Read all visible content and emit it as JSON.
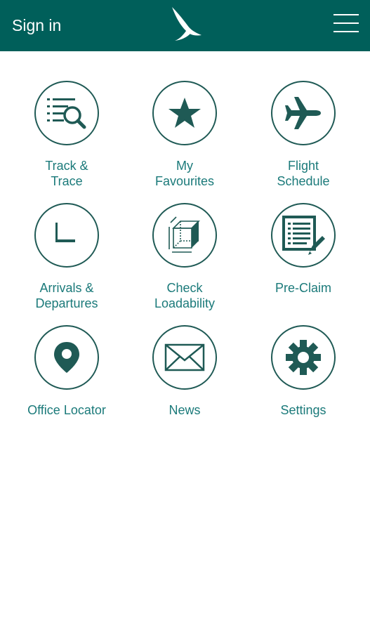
{
  "header": {
    "sign_in_label": "Sign in",
    "logo_icon": "brushwing-logo-icon",
    "menu_icon": "hamburger-menu-icon"
  },
  "colors": {
    "header_bg": "#005f5a",
    "icon_stroke": "#1f5a55",
    "label_text": "#1b7a7a"
  },
  "menu": {
    "tiles": [
      {
        "label": "Track &\nTrace",
        "icon": "search-list-icon"
      },
      {
        "label": "My\nFavourites",
        "icon": "star-icon"
      },
      {
        "label": "Flight\nSchedule",
        "icon": "airplane-icon"
      },
      {
        "label": "Arrivals &\nDepartures",
        "icon": "clock-icon"
      },
      {
        "label": "Check\nLoadability",
        "icon": "cube-icon"
      },
      {
        "label": "Pre-Claim",
        "icon": "form-pencil-icon"
      },
      {
        "label": "Office Locator",
        "icon": "location-pin-icon"
      },
      {
        "label": "News",
        "icon": "envelope-icon"
      },
      {
        "label": "Settings",
        "icon": "gear-icon"
      }
    ]
  }
}
